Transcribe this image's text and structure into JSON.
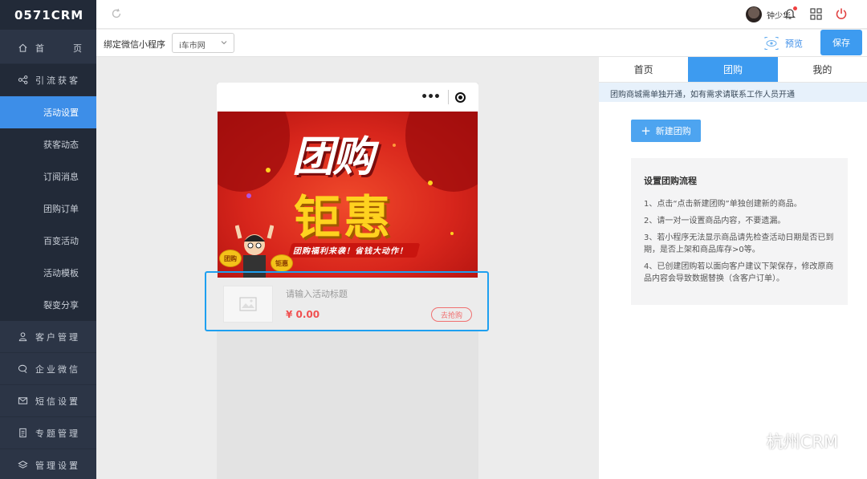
{
  "logo": "0571CRM",
  "sidebar": {
    "items": [
      {
        "label": "首　页",
        "icon": "home-icon"
      },
      {
        "label": "引流获客",
        "icon": "share-icon"
      },
      {
        "label": "客户管理",
        "icon": "user-icon"
      },
      {
        "label": "企业微信",
        "icon": "chat-icon"
      },
      {
        "label": "短信设置",
        "icon": "mail-icon"
      },
      {
        "label": "专题管理",
        "icon": "doc-icon"
      },
      {
        "label": "管理设置",
        "icon": "layers-icon"
      }
    ],
    "home_chars": [
      "首",
      "页"
    ],
    "sub_items": [
      {
        "label": "活动设置",
        "active": true
      },
      {
        "label": "获客动态"
      },
      {
        "label": "订阅消息"
      },
      {
        "label": "团购订单"
      },
      {
        "label": "百变活动"
      },
      {
        "label": "活动模板"
      },
      {
        "label": "裂变分享"
      }
    ]
  },
  "header": {
    "user_name": "钟少华"
  },
  "toolbar": {
    "bind_label": "绑定微信小程序",
    "bind_value": "i车市网",
    "preview_label": "预览",
    "save_label": "保存"
  },
  "phone": {
    "banner": {
      "title1": "团购",
      "title2": "钜惠",
      "slogan": "团购福利来袭！省钱大动作！",
      "coin_left": "团购",
      "coin_right": "钜惠"
    },
    "product": {
      "title_placeholder": "请输入活动标题",
      "price": "¥ 0.00",
      "buy_label": "去抢购"
    }
  },
  "panel": {
    "tabs": [
      {
        "label": "首页"
      },
      {
        "label": "团购",
        "active": true
      },
      {
        "label": "我的"
      }
    ],
    "notice": "团购商城需单独开通，如有需求请联系工作人员开通",
    "new_button": "新建团购",
    "flow_title": "设置团购流程",
    "flow_steps": [
      "1、点击“点击新建团购”单独创建新的商品。",
      "2、请一对一设置商品内容，不要遗漏。",
      "3、若小程序无法显示商品请先检查活动日期是否已到期，是否上架和商品库存>0等。",
      "4、已创建团购若以面向客户建议下架保存，修改原商品内容会导致数据替换（含客户订单）。"
    ]
  },
  "watermark": "杭州CRM",
  "colors": {
    "sidebar_bg": "#2c3546",
    "accent": "#3d9bf0",
    "price": "#f05050",
    "frame": "#1ea0f0"
  }
}
